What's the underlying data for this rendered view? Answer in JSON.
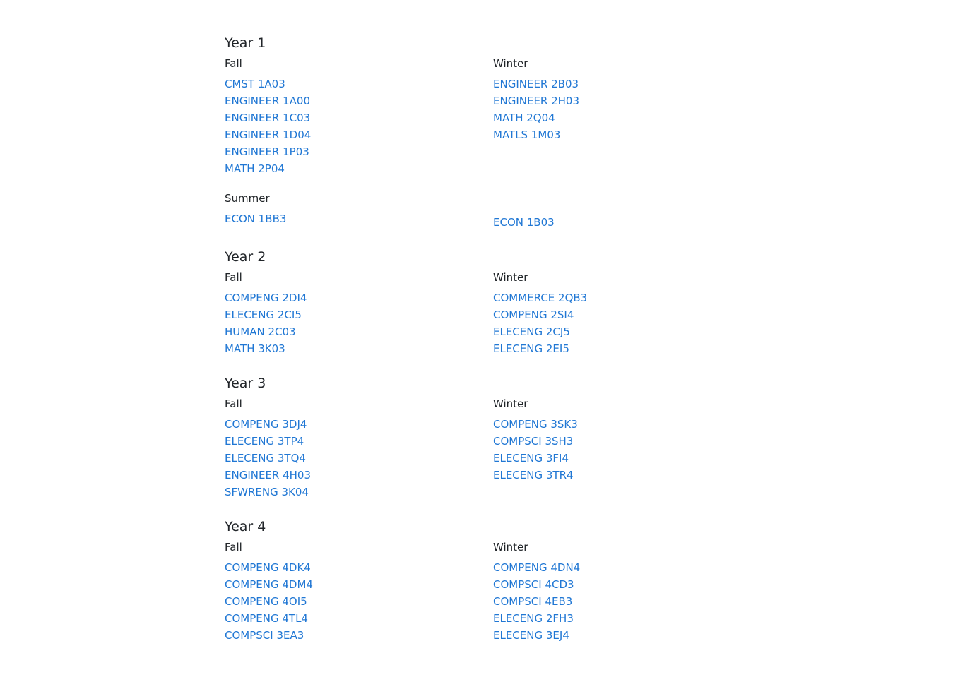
{
  "years": [
    {
      "title": "Year 1",
      "terms": [
        {
          "name": "Fall",
          "courses": [
            "CMST 1A03",
            "ENGINEER 1A00",
            "ENGINEER 1C03",
            "ENGINEER 1D04",
            "ENGINEER 1P03",
            "MATH 2P04"
          ]
        },
        {
          "name": "Winter",
          "courses": [
            "ENGINEER 2B03",
            "ENGINEER 2H03",
            "MATH 2Q04",
            "MATLS 1M03"
          ]
        },
        {
          "name": "Summer",
          "courses": [
            "ECON 1BB3"
          ]
        },
        {
          "name": "",
          "courses": [
            "ECON 1B03"
          ]
        }
      ]
    },
    {
      "title": "Year 2",
      "terms": [
        {
          "name": "Fall",
          "courses": [
            "COMPENG 2DI4",
            "ELECENG 2CI5",
            "HUMAN 2C03",
            "MATH 3K03"
          ]
        },
        {
          "name": "Winter",
          "courses": [
            "COMMERCE 2QB3",
            "COMPENG 2SI4",
            "ELECENG 2CJ5",
            "ELECENG 2EI5"
          ]
        }
      ]
    },
    {
      "title": "Year 3",
      "terms": [
        {
          "name": "Fall",
          "courses": [
            "COMPENG 3DJ4",
            "ELECENG 3TP4",
            "ELECENG 3TQ4",
            "ENGINEER 4H03",
            "SFWRENG 3K04"
          ]
        },
        {
          "name": "Winter",
          "courses": [
            "COMPENG 3SK3",
            "COMPSCI 3SH3",
            "ELECENG 3FI4",
            "ELECENG 3TR4"
          ]
        }
      ]
    },
    {
      "title": "Year 4",
      "terms": [
        {
          "name": "Fall",
          "courses": [
            "COMPENG 4DK4",
            "COMPENG 4DM4",
            "COMPENG 4OI5",
            "COMPENG 4TL4",
            "COMPSCI 3EA3"
          ]
        },
        {
          "name": "Winter",
          "courses": [
            "COMPENG 4DN4",
            "COMPSCI 4CD3",
            "COMPSCI 4EB3",
            "ELECENG 2FH3",
            "ELECENG 3EJ4"
          ]
        }
      ]
    }
  ]
}
